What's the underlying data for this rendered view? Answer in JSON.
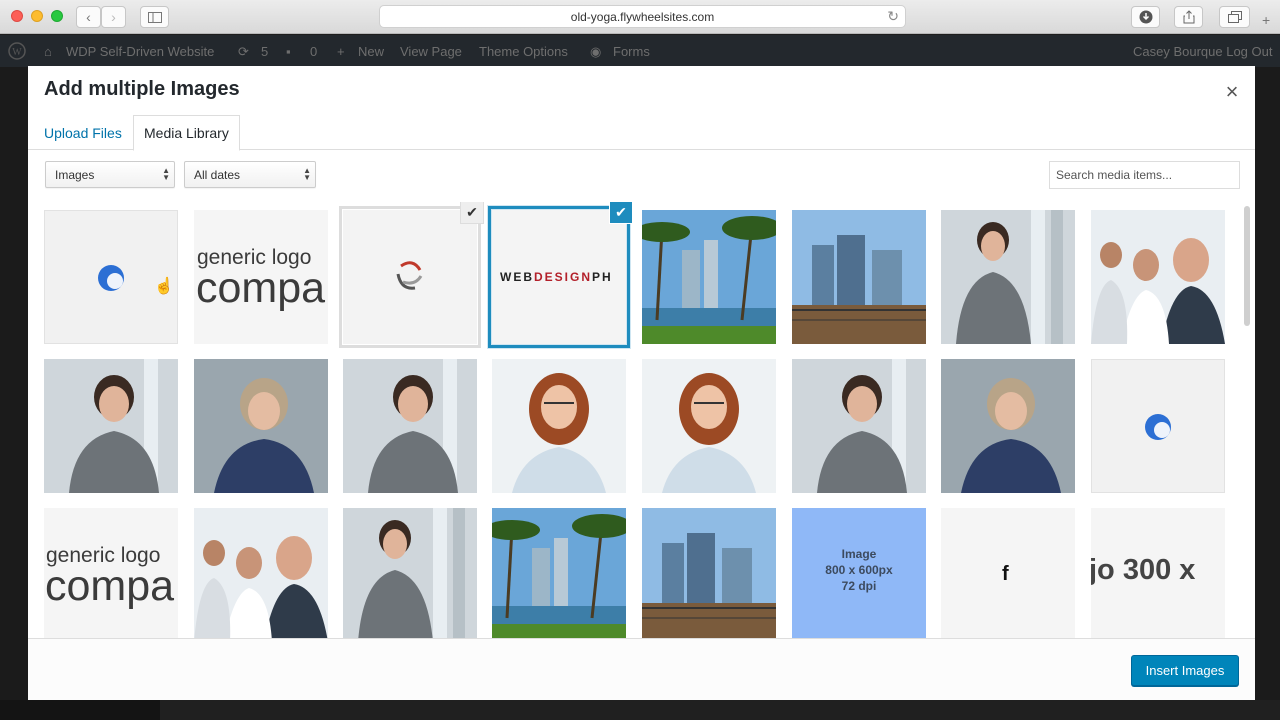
{
  "browser": {
    "url": "old-yoga.flywheelsites.com"
  },
  "adminbar": {
    "site_name": "WDP Self-Driven Website",
    "updates": "5",
    "comments": "0",
    "new_label": "New",
    "view_page": "View Page",
    "theme_options": "Theme Options",
    "forms": "Forms",
    "user": "Casey Bourque Log Out"
  },
  "modal": {
    "title": "Add multiple Images",
    "close_glyph": "×",
    "tabs": [
      {
        "label": "Upload Files"
      },
      {
        "label": "Media Library"
      }
    ],
    "filters": {
      "type_value": "Images",
      "date_value": "All dates"
    },
    "search": {
      "placeholder": "Search media items..."
    },
    "insert_label": "Insert Images"
  },
  "tiles": {
    "logo_text_top": "generic logo",
    "logo_text_bottom": "compa",
    "webdesign_part1": "WEB",
    "webdesign_part2": "DESIGN",
    "webdesign_part3": "PH",
    "placeholder_lines": [
      "Image",
      "800 x 600px",
      "72 dpi"
    ],
    "f_letter": "f",
    "logo300": "jo 300 x"
  },
  "colors": {
    "accent": "#0085ba",
    "selected_border": "#1e8cbe",
    "placeholder_bg": "#8fb8f7"
  }
}
